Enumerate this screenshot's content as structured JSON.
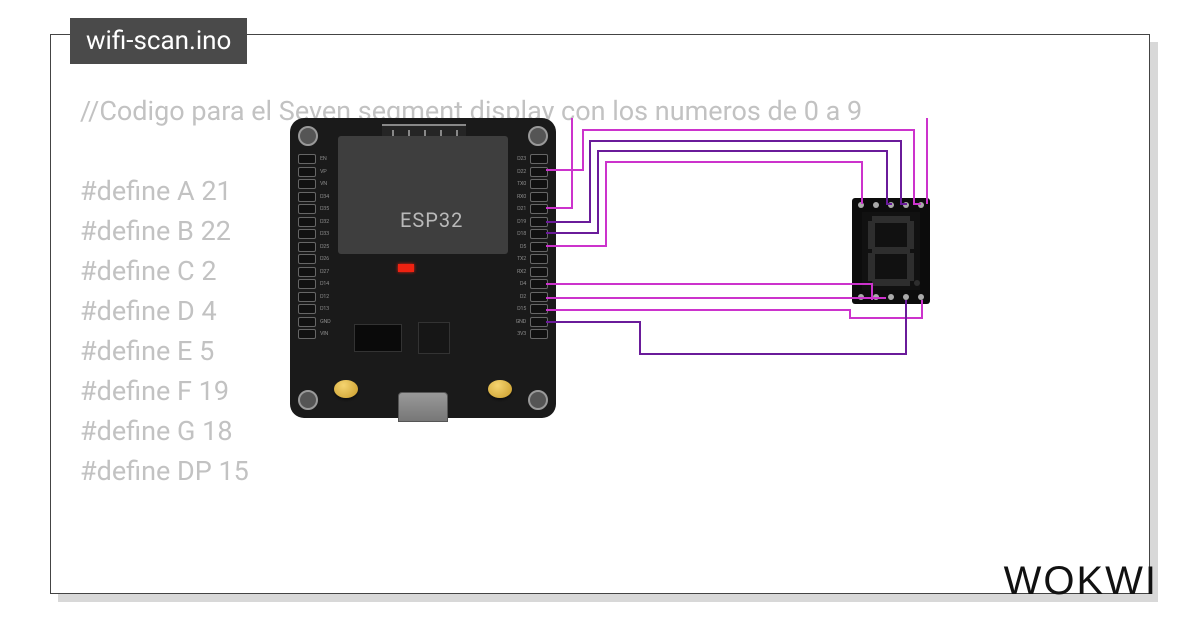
{
  "tab": {
    "filename": "wifi-scan.ino"
  },
  "code": {
    "comment": "//Codigo para el Seven segment display con los numeros de 0 a 9",
    "blank": "",
    "defines": [
      "#define A 21",
      "#define B 22",
      "#define C 2",
      "#define D 4",
      "#define E 5",
      "#define F 19",
      "#define G 18",
      "#define DP 15"
    ]
  },
  "board": {
    "chip_label": "ESP32",
    "pins_left": [
      "EN",
      "VP",
      "VN",
      "D34",
      "D35",
      "D32",
      "D33",
      "D25",
      "D26",
      "D27",
      "D14",
      "D12",
      "D13",
      "GND",
      "VIN"
    ],
    "pins_right": [
      "D23",
      "D22",
      "TX0",
      "RX0",
      "D21",
      "D19",
      "D18",
      "D5",
      "TX2",
      "RX2",
      "D4",
      "D2",
      "D15",
      "GND",
      "3V3"
    ]
  },
  "sevenseg": {
    "pin_count_top": 5,
    "pin_count_bottom": 5,
    "segments": [
      "a",
      "b",
      "c",
      "d",
      "e",
      "f",
      "g",
      "dp"
    ]
  },
  "wire_colors": {
    "magenta": "#cc33cc",
    "purple": "#6a1b9a"
  },
  "logo": "WOKWI"
}
